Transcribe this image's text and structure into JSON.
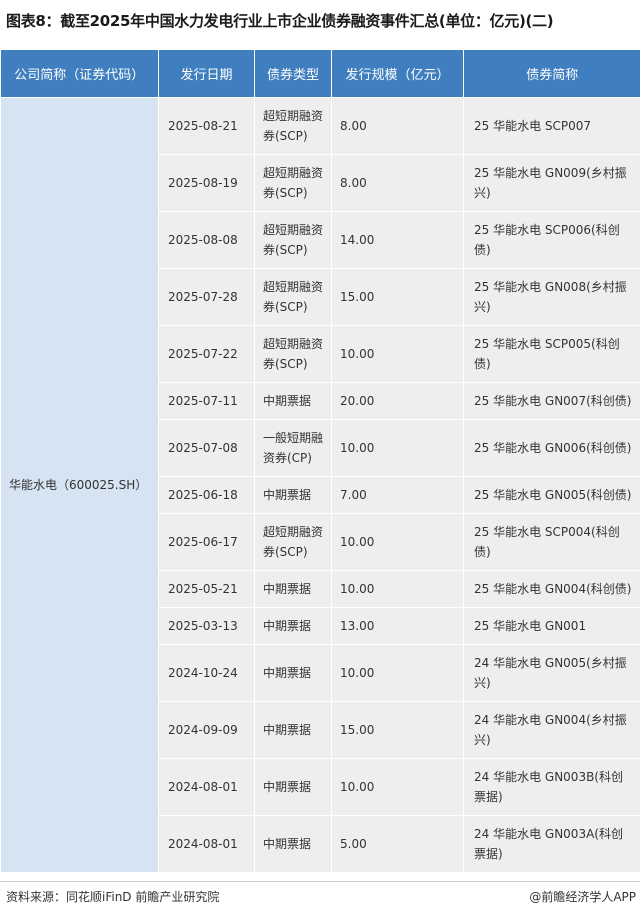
{
  "title": "图表8：截至2025年中国水力发电行业上市企业债券融资事件汇总(单位：亿元)(二)",
  "table": {
    "headers": [
      "公司简称（证券代码）",
      "发行日期",
      "债券类型",
      "发行规模（亿元）",
      "债券简称"
    ],
    "company": "华能水电（600025.SH）",
    "rows": [
      {
        "date": "2025-08-21",
        "type": "超短期融资券(SCP)",
        "size": "8.00",
        "name": "25 华能水电 SCP007"
      },
      {
        "date": "2025-08-19",
        "type": "超短期融资券(SCP)",
        "size": "8.00",
        "name": "25 华能水电 GN009(乡村振兴)"
      },
      {
        "date": "2025-08-08",
        "type": "超短期融资券(SCP)",
        "size": "14.00",
        "name": "25 华能水电 SCP006(科创债)"
      },
      {
        "date": "2025-07-28",
        "type": "超短期融资券(SCP)",
        "size": "15.00",
        "name": "25 华能水电 GN008(乡村振兴)"
      },
      {
        "date": "2025-07-22",
        "type": "超短期融资券(SCP)",
        "size": "10.00",
        "name": "25 华能水电 SCP005(科创债)"
      },
      {
        "date": "2025-07-11",
        "type": "中期票据",
        "size": "20.00",
        "name": "25 华能水电 GN007(科创债)"
      },
      {
        "date": "2025-07-08",
        "type": "一般短期融资券(CP)",
        "size": "10.00",
        "name": "25 华能水电 GN006(科创债)"
      },
      {
        "date": "2025-06-18",
        "type": "中期票据",
        "size": "7.00",
        "name": "25 华能水电 GN005(科创债)"
      },
      {
        "date": "2025-06-17",
        "type": "超短期融资券(SCP)",
        "size": "10.00",
        "name": "25 华能水电 SCP004(科创债)"
      },
      {
        "date": "2025-05-21",
        "type": "中期票据",
        "size": "10.00",
        "name": "25 华能水电 GN004(科创债)"
      },
      {
        "date": "2025-03-13",
        "type": "中期票据",
        "size": "13.00",
        "name": "25 华能水电 GN001"
      },
      {
        "date": "2024-10-24",
        "type": "中期票据",
        "size": "10.00",
        "name": "24 华能水电 GN005(乡村振兴)"
      },
      {
        "date": "2024-09-09",
        "type": "中期票据",
        "size": "15.00",
        "name": "24 华能水电 GN004(乡村振兴)"
      },
      {
        "date": "2024-08-01",
        "type": "中期票据",
        "size": "10.00",
        "name": "24 华能水电 GN003B(科创票据)"
      },
      {
        "date": "2024-08-01",
        "type": "中期票据",
        "size": "5.00",
        "name": "24 华能水电 GN003A(科创票据)"
      }
    ]
  },
  "footer": {
    "source": "资料来源：同花顺iFinD 前瞻产业研究院",
    "brand": "@前瞻经济学人APP"
  },
  "colors": {
    "header_bg": "#3f7fbf",
    "company_cell_bg": "#d5e3f2",
    "row_bg": "#eeeeee"
  }
}
